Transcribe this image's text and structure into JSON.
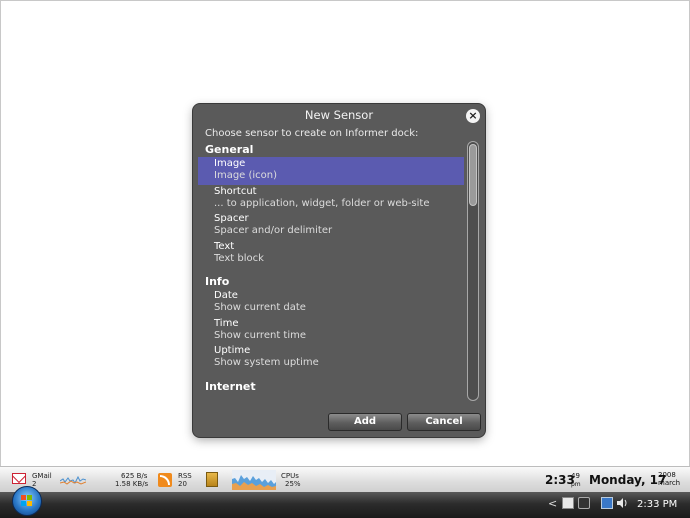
{
  "dialog": {
    "title": "New Sensor",
    "prompt": "Choose sensor to create on Informer dock:",
    "groups": [
      {
        "label": "General",
        "items": [
          {
            "title": "Image",
            "subtitle": "Image (icon)"
          },
          {
            "title": "Shortcut",
            "subtitle": "... to application, widget, folder or web-site"
          },
          {
            "title": "Spacer",
            "subtitle": "Spacer and/or delimiter"
          },
          {
            "title": "Text",
            "subtitle": "Text block"
          }
        ]
      },
      {
        "label": "Info",
        "items": [
          {
            "title": "Date",
            "subtitle": "Show current date"
          },
          {
            "title": "Time",
            "subtitle": "Show current time"
          },
          {
            "title": "Uptime",
            "subtitle": "Show system uptime"
          }
        ]
      },
      {
        "label": "Internet",
        "items": []
      }
    ],
    "selected": "Image",
    "add_label": "Add",
    "cancel_label": "Cancel",
    "close_glyph": "×"
  },
  "dock": {
    "gmail_label": "GMail",
    "gmail_count": "2",
    "net_down": "625 B/s",
    "net_up": "1.58 KB/s",
    "rss_label": "RSS",
    "rss_count": "20",
    "cpu_label": "CPUs",
    "cpu_value": "25%",
    "time": "2:33",
    "seconds": "49",
    "ampm": "pm",
    "date": "Monday, 17",
    "year": "2008",
    "month": "march"
  },
  "taskbar": {
    "chevron": "<",
    "clock": "2:33 PM"
  }
}
